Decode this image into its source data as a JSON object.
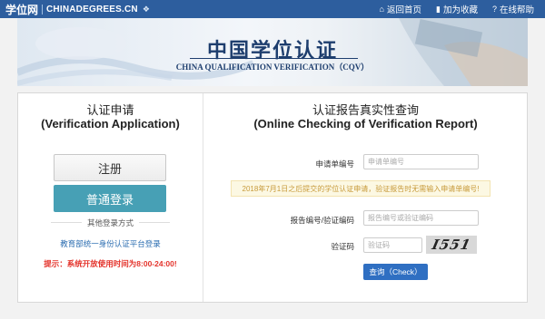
{
  "header": {
    "logo_cn": "学位网",
    "logo_en": "CHINADEGREES.CN",
    "links": [
      {
        "icon": "home-icon",
        "label": "返回首页"
      },
      {
        "icon": "bookmark-icon",
        "label": "加为收藏"
      },
      {
        "icon": "question-icon",
        "label": "在线帮助"
      }
    ]
  },
  "banner": {
    "title_cn": "中国学位认证",
    "title_en": "CHINA QUALIFICATION VERIFICATION（CQV）"
  },
  "left": {
    "title_cn": "认证申请",
    "title_en": "(Verification Application)",
    "register_label": "注册",
    "login_label": "普通登录",
    "other_login": "其他登录方式",
    "auth_link": "教育部统一身份认证平台登录",
    "hint": "提示：系统开放使用时间为8:00-24:00!"
  },
  "right": {
    "title_cn": "认证报告真实性查询",
    "title_en": "(Online Checking of Verification Report)",
    "app_no_label": "申请单编号",
    "app_no_placeholder": "申请单编号",
    "notice": "2018年7月1日之后提交的学位认证申请，验证报告时无需输入申请单编号!",
    "report_no_label": "报告编号/验证编码",
    "report_no_placeholder": "报告编号或验证编码",
    "captcha_label": "验证码",
    "captcha_placeholder": "验证码",
    "captcha_text": "I551",
    "check_label": "查询（Check）"
  },
  "colors": {
    "topbar": "#2d5e9e",
    "login_button": "#47a0b5",
    "check_button": "#2f6fc2",
    "hint_red": "#e4332b",
    "link_blue": "#2a6cb0"
  }
}
